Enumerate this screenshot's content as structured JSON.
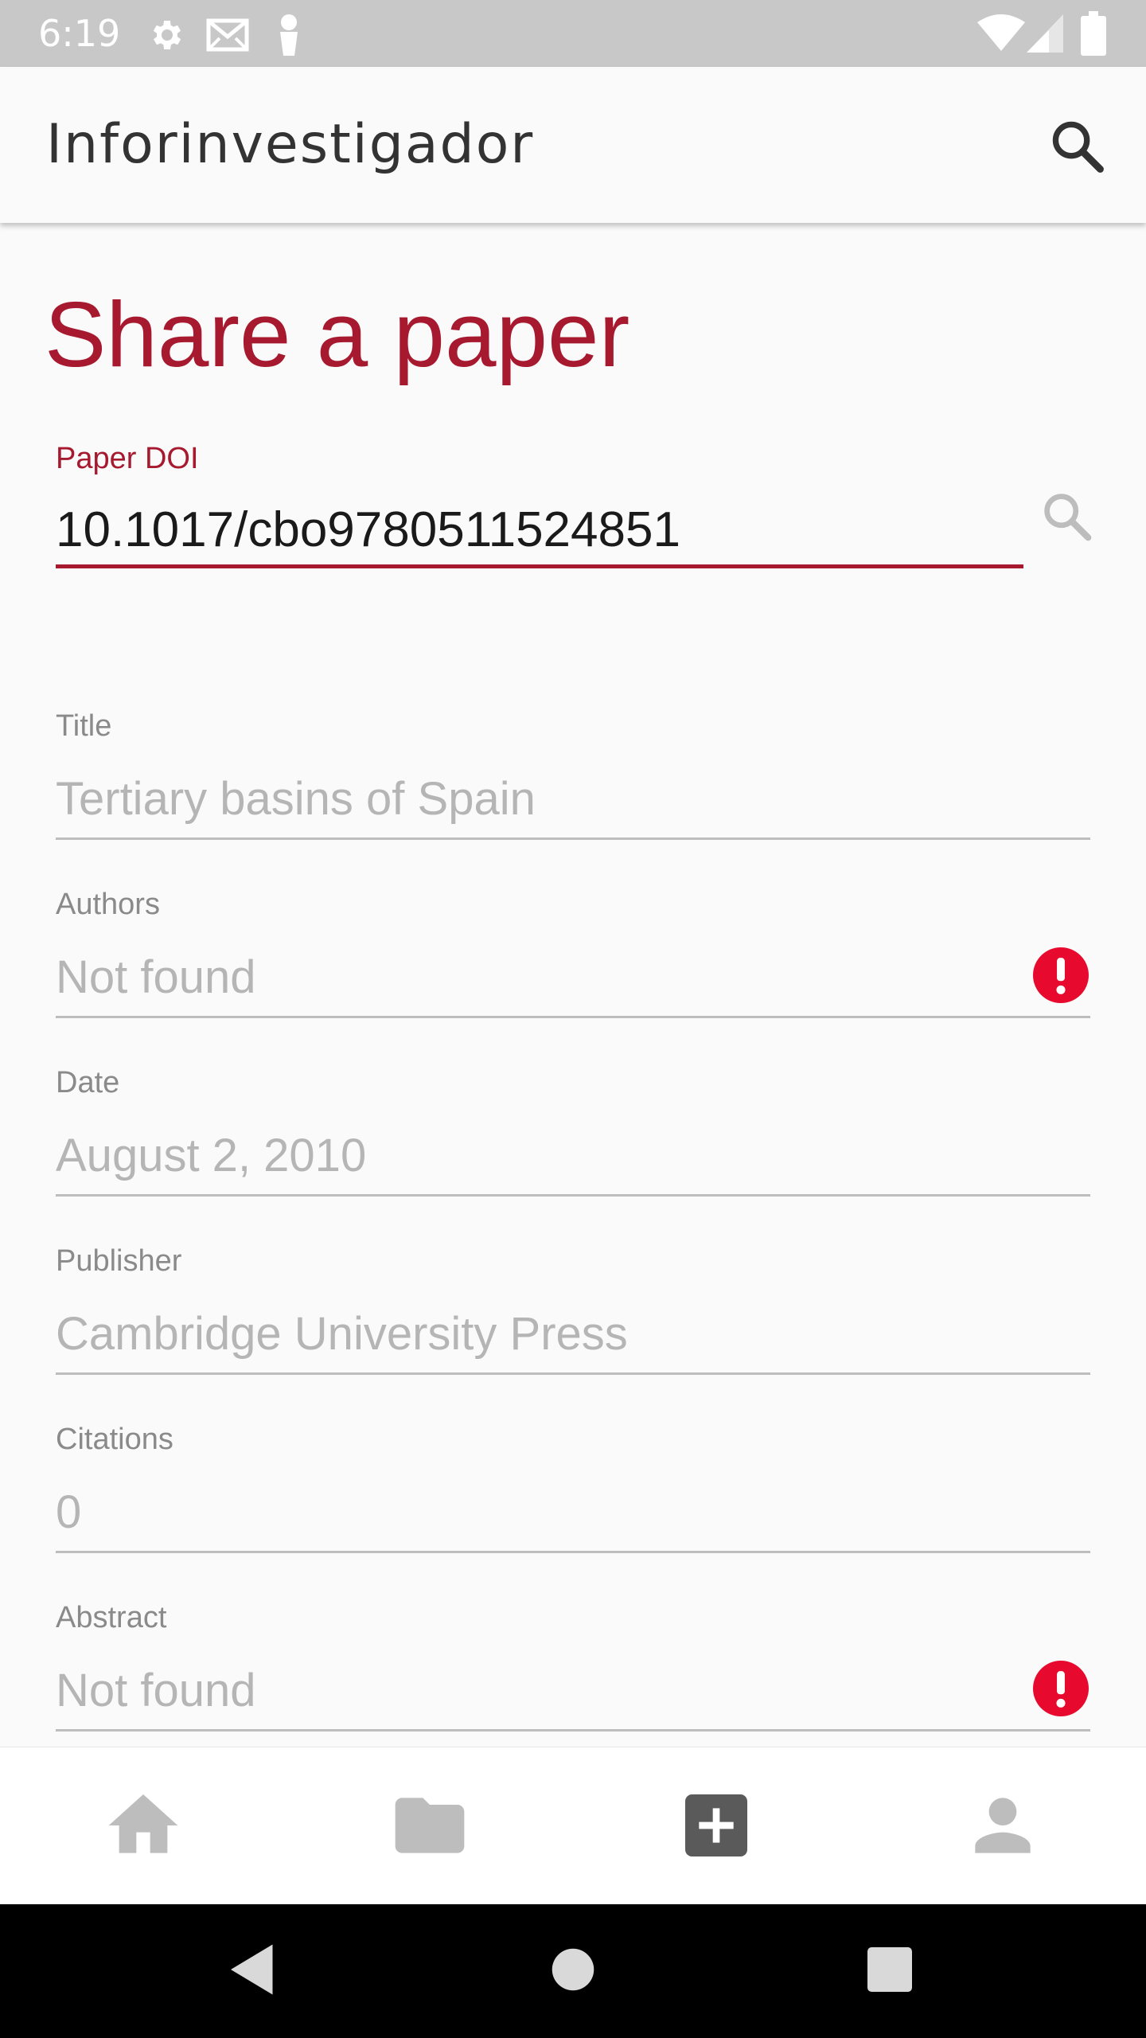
{
  "status_bar": {
    "time": "6:19",
    "left_icons": [
      "gear-icon",
      "gmail-icon",
      "person-icon"
    ],
    "right_icons": [
      "wifi-icon",
      "signal-icon",
      "battery-icon"
    ]
  },
  "app_bar": {
    "title": "Inforinvestigador",
    "search_icon": "search-icon"
  },
  "page": {
    "heading": "Share a paper"
  },
  "doi_field": {
    "label": "Paper DOI",
    "value": "10.1017/cbo9780511524851",
    "search_icon": "search-icon"
  },
  "fields": {
    "title": {
      "label": "Title",
      "value": "Tertiary basins of Spain"
    },
    "authors": {
      "label": "Authors",
      "value": "Not found",
      "error": true
    },
    "date": {
      "label": "Date",
      "value": "August 2, 2010"
    },
    "publisher": {
      "label": "Publisher",
      "value": "Cambridge University Press"
    },
    "citations": {
      "label": "Citations",
      "value": "0"
    },
    "abstract": {
      "label": "Abstract",
      "value": "Not found",
      "error": true
    }
  },
  "bottom_nav": {
    "items": [
      "home-icon",
      "folder-icon",
      "add-box-icon",
      "account-icon"
    ],
    "active": "add-box-icon"
  },
  "system_nav": [
    "back-icon",
    "home-circle-icon",
    "recents-icon"
  ],
  "colors": {
    "accent": "#a6192e",
    "error": "#e8092e",
    "status_bar": "#c8c8c8",
    "disabled_text": "#b5b5b5"
  }
}
